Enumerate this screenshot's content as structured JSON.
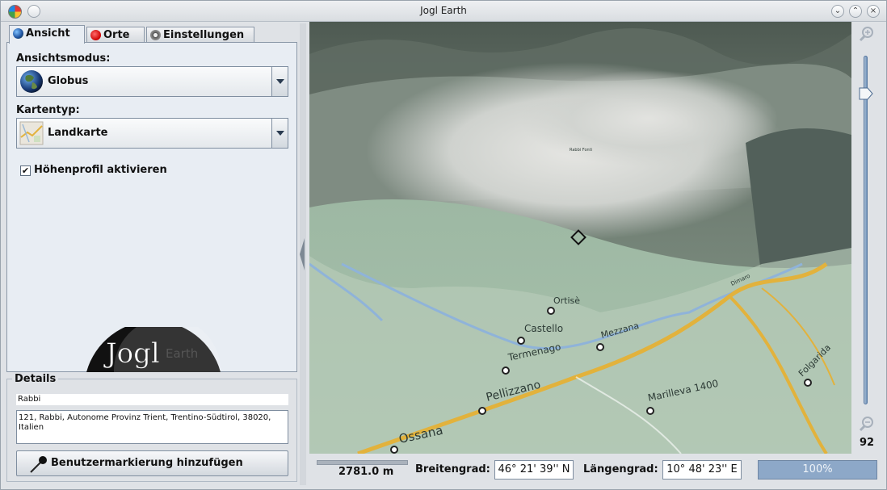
{
  "window": {
    "title": "Jogl Earth"
  },
  "tabs": [
    {
      "label": "Ansicht",
      "icon": "globe-icon",
      "active": true
    },
    {
      "label": "Orte",
      "icon": "pushpin-icon",
      "active": false
    },
    {
      "label": "Einstellungen",
      "icon": "gear-icon",
      "active": false
    }
  ],
  "view": {
    "mode_label": "Ansichtsmodus:",
    "mode_value": "Globus",
    "maptype_label": "Kartentyp:",
    "maptype_value": "Landkarte",
    "elevation_label": "Höhenprofil aktivieren",
    "elevation_checked": true,
    "logo_text": "Jogl",
    "logo_suffix": "Earth"
  },
  "details": {
    "legend": "Details",
    "name": "Rabbi",
    "address": "121, Rabbi, Autonome Provinz Trient, Trentino-Südtirol, 38020, Italien",
    "add_button": "Benutzermarkierung hinzufügen"
  },
  "map": {
    "places": [
      "Ortisè",
      "Castello",
      "Termenago",
      "Mezzana",
      "Pellizzano",
      "Ossana",
      "Marilleva 1400",
      "Folgarida",
      "Dimaro",
      "Rabbi Fonti"
    ]
  },
  "zoom": {
    "value": "92",
    "level_percent": 5
  },
  "status": {
    "scale": "2781.0 m",
    "lat_label": "Breitengrad:",
    "lat_value": "46° 21' 39'' N",
    "lon_label": "Längengrad:",
    "lon_value": "10° 48' 23'' E",
    "progress": "100%"
  },
  "colors": {
    "road": "#e2b23c",
    "river": "#8fb3d9",
    "progress": "#8da8c8",
    "slider": "#6b8fb8"
  }
}
